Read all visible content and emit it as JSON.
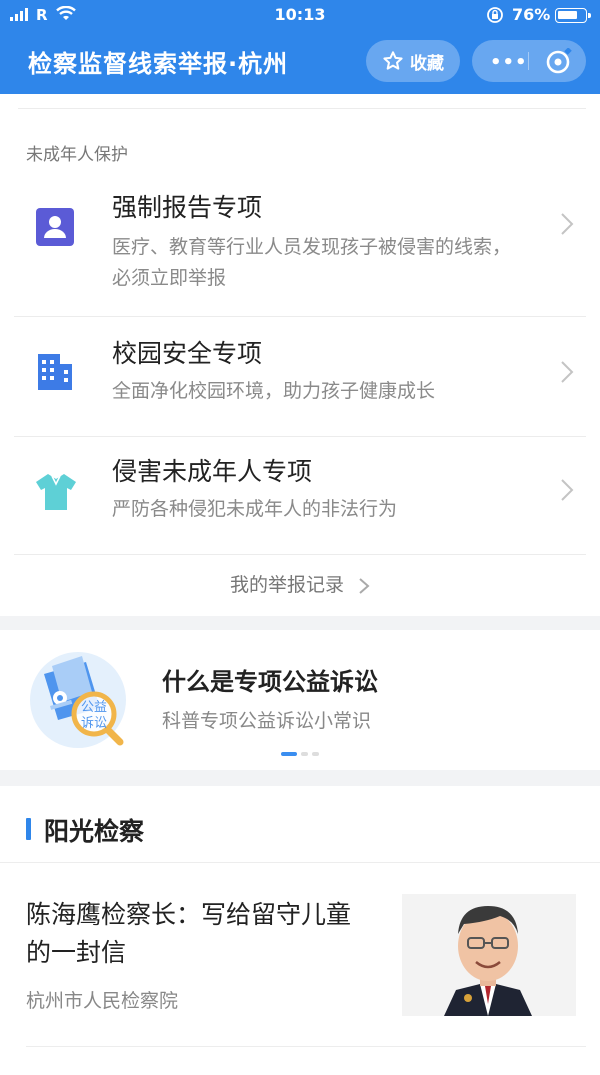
{
  "status_bar": {
    "carrier": "R",
    "time": "10:13",
    "battery": "76%",
    "battery_level": 0.76
  },
  "header": {
    "title": "检察监督线索举报·杭州",
    "favorite_label": "收藏",
    "more_label": "•••",
    "colors": {
      "primary": "#2f86ea"
    }
  },
  "protection": {
    "section_label": "未成年人保护",
    "items": [
      {
        "title": "强制报告专项",
        "desc_line1": "医疗、教育等行业人员发现孩子被侵害的线索，",
        "desc_line2": "必须立即举报",
        "icon": "user-badge-icon",
        "icon_color": "#5b5bd6"
      },
      {
        "title": "校园安全专项",
        "desc_line1": "全面净化校园环境，助力孩子健康成长",
        "icon": "building-icon",
        "icon_color": "#3d7be6"
      },
      {
        "title": "侵害未成年人专项",
        "desc_line1": "严防各种侵犯未成年人的非法行为",
        "icon": "tshirt-icon",
        "icon_color": "#5ed0d6"
      }
    ],
    "records_link": "我的举报记录"
  },
  "banner": {
    "title": "什么是专项公益诉讼",
    "subtitle": "科普专项公益诉讼小常识",
    "image_text_line1": "公益",
    "image_text_line2": "诉讼",
    "active_slide": 0
  },
  "sunshine": {
    "heading": "阳光检察",
    "articles": [
      {
        "title": "陈海鹰检察长：写给留守儿童的一封信",
        "source": "杭州市人民检察院"
      }
    ]
  }
}
